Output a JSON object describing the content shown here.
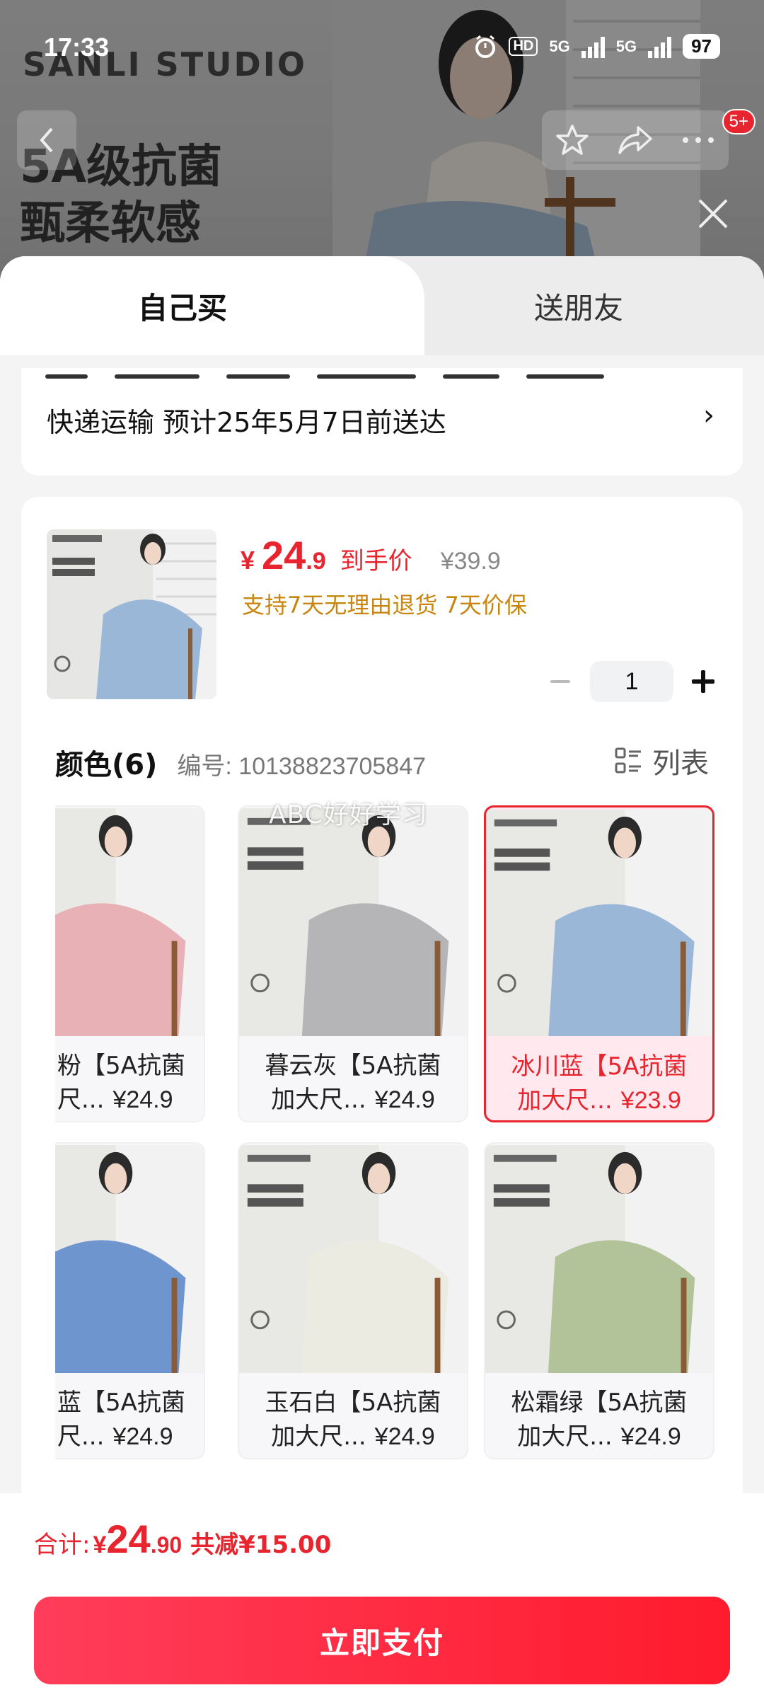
{
  "status": {
    "time": "17:33",
    "hd_label": "HD",
    "net1": "5G",
    "net2": "5G",
    "battery": "97"
  },
  "background": {
    "brand": "SANLI STUDIO",
    "slogan_line1": "5A级抗菌",
    "slogan_line2": "甄柔软感",
    "badge": "5+"
  },
  "tabs": {
    "self": "自己买",
    "gift": "送朋友"
  },
  "delivery": {
    "text": "快递运输 预计25年5月7日前送达",
    "chevron": "›"
  },
  "product": {
    "currency": "¥",
    "price_int": "24",
    "price_dec": ".9",
    "price_label": "到手价",
    "original_price": "¥39.9",
    "promo": "支持7天无理由退货 7天价保",
    "quantity": "1"
  },
  "colors": {
    "title": "颜色(6)",
    "sku": "编号: 10138823705847",
    "list_toggle": "列表",
    "watermark": "ABC好好学习",
    "items": [
      {
        "name": "粉【5A抗菌",
        "sub": "尺...",
        "price": "¥24.9",
        "color": "#e7b1b5",
        "selected": false
      },
      {
        "name": "暮云灰【5A抗菌",
        "sub": "加大尺...",
        "price": "¥24.9",
        "color": "#b5b5b7",
        "selected": false
      },
      {
        "name": "冰川蓝【5A抗菌",
        "sub": "加大尺...",
        "price": "¥23.9",
        "color": "#9bb7d8",
        "selected": true
      },
      {
        "name": "蓝【5A抗菌",
        "sub": "尺...",
        "price": "¥24.9",
        "color": "#6f95cf",
        "selected": false
      },
      {
        "name": "玉石白【5A抗菌",
        "sub": "加大尺...",
        "price": "¥24.9",
        "color": "#ecebe2",
        "selected": false
      },
      {
        "name": "松霜绿【5A抗菌",
        "sub": "加大尺...",
        "price": "¥24.9",
        "color": "#b2c39a",
        "selected": false
      }
    ]
  },
  "footer": {
    "total_label": "合计:",
    "currency": "¥",
    "total_int": "24",
    "total_dec": ".90",
    "saved": "共减¥15.00",
    "pay_button": "立即支付"
  }
}
